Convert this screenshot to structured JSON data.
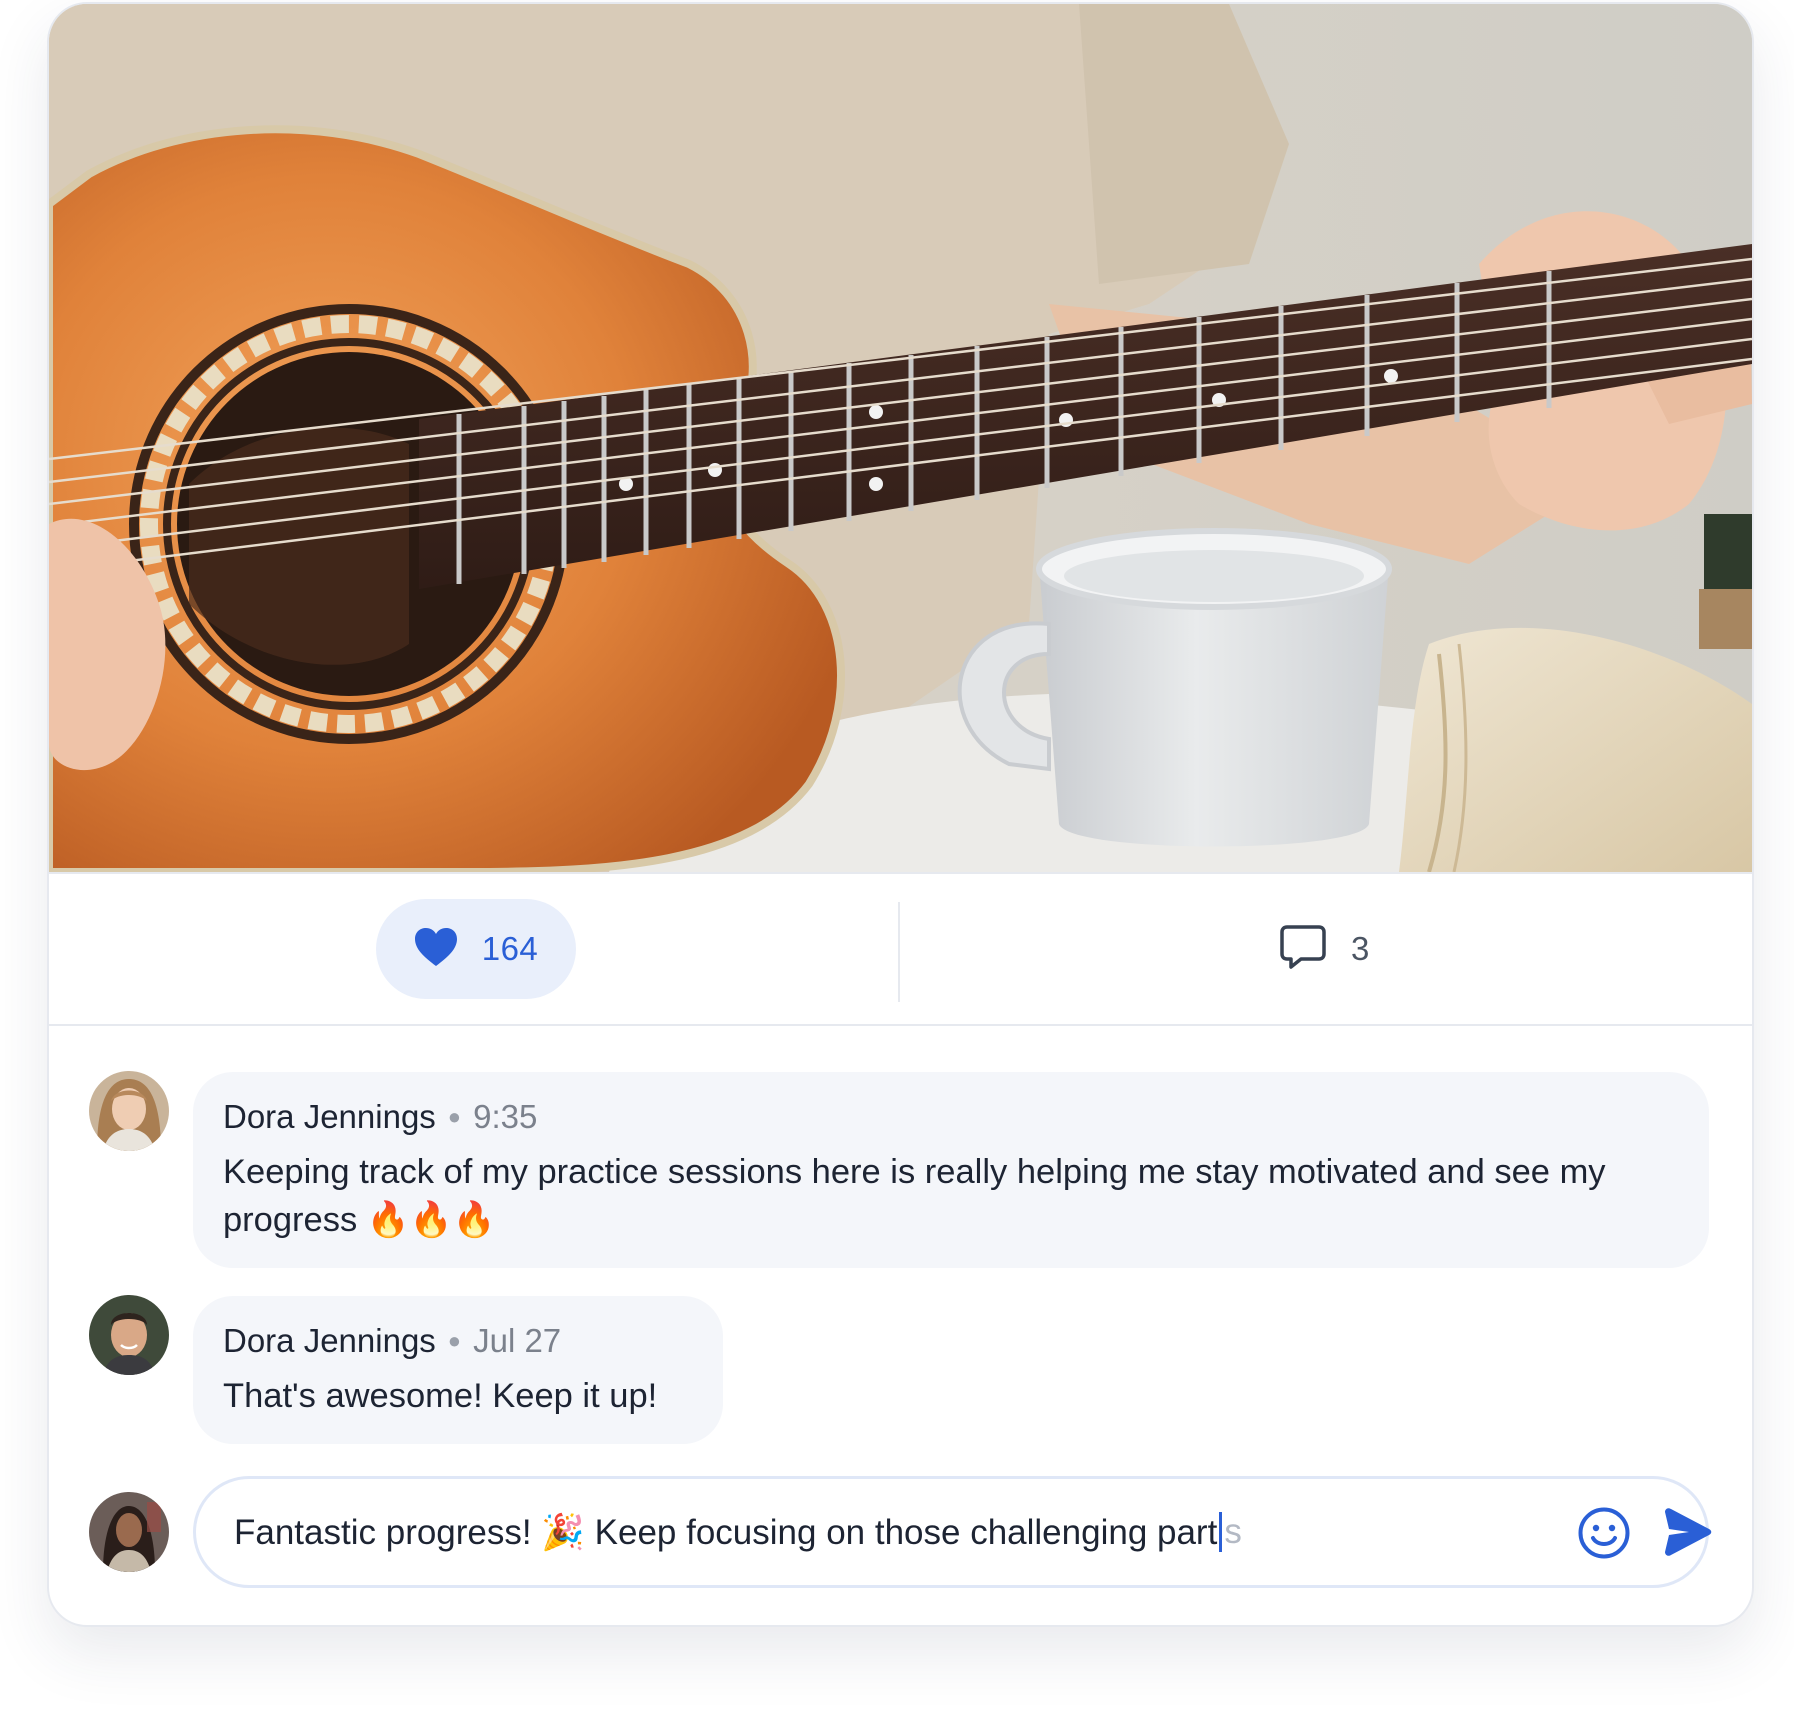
{
  "post": {
    "image_alt": "Person playing an acoustic guitar next to a white mug and an open book",
    "likes": "164",
    "comments_count": "3"
  },
  "comments": [
    {
      "author": "Dora Jennings",
      "time": "9:35",
      "text": "Keeping track of my practice sessions here is really helping me stay motivated and see my progress 🔥🔥🔥"
    },
    {
      "author": "Dora Jennings",
      "time": "Jul 27",
      "text": "That's awesome! Keep it up!"
    }
  ],
  "composer": {
    "typed_text": "Fantastic progress! 🎉 Keep focusing on those challenging part",
    "suggestion": "s"
  },
  "icons": {
    "like": "heart-icon",
    "comment": "speech-bubble-icon",
    "emoji": "smiley-icon",
    "send": "send-icon"
  },
  "colors": {
    "accent": "#2a5fd6",
    "like_bg": "#e9effb",
    "bubble_bg": "#f4f6fa",
    "border": "#e6e9ef"
  }
}
